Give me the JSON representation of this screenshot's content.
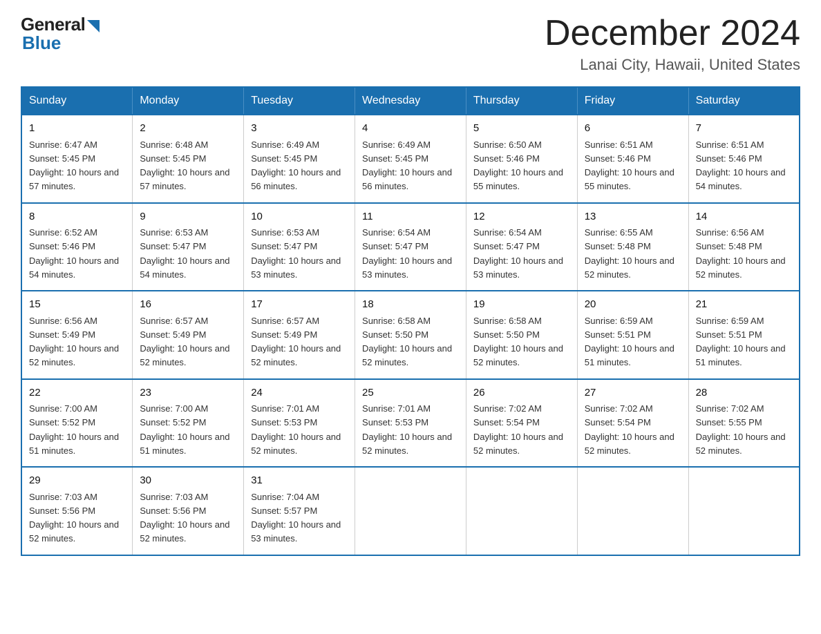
{
  "logo": {
    "general": "General",
    "blue": "Blue",
    "triangle_color": "#1a6faf"
  },
  "title": {
    "month_year": "December 2024",
    "location": "Lanai City, Hawaii, United States"
  },
  "weekdays": [
    "Sunday",
    "Monday",
    "Tuesday",
    "Wednesday",
    "Thursday",
    "Friday",
    "Saturday"
  ],
  "weeks": [
    [
      {
        "day": "1",
        "sunrise": "6:47 AM",
        "sunset": "5:45 PM",
        "daylight": "10 hours and 57 minutes."
      },
      {
        "day": "2",
        "sunrise": "6:48 AM",
        "sunset": "5:45 PM",
        "daylight": "10 hours and 57 minutes."
      },
      {
        "day": "3",
        "sunrise": "6:49 AM",
        "sunset": "5:45 PM",
        "daylight": "10 hours and 56 minutes."
      },
      {
        "day": "4",
        "sunrise": "6:49 AM",
        "sunset": "5:45 PM",
        "daylight": "10 hours and 56 minutes."
      },
      {
        "day": "5",
        "sunrise": "6:50 AM",
        "sunset": "5:46 PM",
        "daylight": "10 hours and 55 minutes."
      },
      {
        "day": "6",
        "sunrise": "6:51 AM",
        "sunset": "5:46 PM",
        "daylight": "10 hours and 55 minutes."
      },
      {
        "day": "7",
        "sunrise": "6:51 AM",
        "sunset": "5:46 PM",
        "daylight": "10 hours and 54 minutes."
      }
    ],
    [
      {
        "day": "8",
        "sunrise": "6:52 AM",
        "sunset": "5:46 PM",
        "daylight": "10 hours and 54 minutes."
      },
      {
        "day": "9",
        "sunrise": "6:53 AM",
        "sunset": "5:47 PM",
        "daylight": "10 hours and 54 minutes."
      },
      {
        "day": "10",
        "sunrise": "6:53 AM",
        "sunset": "5:47 PM",
        "daylight": "10 hours and 53 minutes."
      },
      {
        "day": "11",
        "sunrise": "6:54 AM",
        "sunset": "5:47 PM",
        "daylight": "10 hours and 53 minutes."
      },
      {
        "day": "12",
        "sunrise": "6:54 AM",
        "sunset": "5:47 PM",
        "daylight": "10 hours and 53 minutes."
      },
      {
        "day": "13",
        "sunrise": "6:55 AM",
        "sunset": "5:48 PM",
        "daylight": "10 hours and 52 minutes."
      },
      {
        "day": "14",
        "sunrise": "6:56 AM",
        "sunset": "5:48 PM",
        "daylight": "10 hours and 52 minutes."
      }
    ],
    [
      {
        "day": "15",
        "sunrise": "6:56 AM",
        "sunset": "5:49 PM",
        "daylight": "10 hours and 52 minutes."
      },
      {
        "day": "16",
        "sunrise": "6:57 AM",
        "sunset": "5:49 PM",
        "daylight": "10 hours and 52 minutes."
      },
      {
        "day": "17",
        "sunrise": "6:57 AM",
        "sunset": "5:49 PM",
        "daylight": "10 hours and 52 minutes."
      },
      {
        "day": "18",
        "sunrise": "6:58 AM",
        "sunset": "5:50 PM",
        "daylight": "10 hours and 52 minutes."
      },
      {
        "day": "19",
        "sunrise": "6:58 AM",
        "sunset": "5:50 PM",
        "daylight": "10 hours and 52 minutes."
      },
      {
        "day": "20",
        "sunrise": "6:59 AM",
        "sunset": "5:51 PM",
        "daylight": "10 hours and 51 minutes."
      },
      {
        "day": "21",
        "sunrise": "6:59 AM",
        "sunset": "5:51 PM",
        "daylight": "10 hours and 51 minutes."
      }
    ],
    [
      {
        "day": "22",
        "sunrise": "7:00 AM",
        "sunset": "5:52 PM",
        "daylight": "10 hours and 51 minutes."
      },
      {
        "day": "23",
        "sunrise": "7:00 AM",
        "sunset": "5:52 PM",
        "daylight": "10 hours and 51 minutes."
      },
      {
        "day": "24",
        "sunrise": "7:01 AM",
        "sunset": "5:53 PM",
        "daylight": "10 hours and 52 minutes."
      },
      {
        "day": "25",
        "sunrise": "7:01 AM",
        "sunset": "5:53 PM",
        "daylight": "10 hours and 52 minutes."
      },
      {
        "day": "26",
        "sunrise": "7:02 AM",
        "sunset": "5:54 PM",
        "daylight": "10 hours and 52 minutes."
      },
      {
        "day": "27",
        "sunrise": "7:02 AM",
        "sunset": "5:54 PM",
        "daylight": "10 hours and 52 minutes."
      },
      {
        "day": "28",
        "sunrise": "7:02 AM",
        "sunset": "5:55 PM",
        "daylight": "10 hours and 52 minutes."
      }
    ],
    [
      {
        "day": "29",
        "sunrise": "7:03 AM",
        "sunset": "5:56 PM",
        "daylight": "10 hours and 52 minutes."
      },
      {
        "day": "30",
        "sunrise": "7:03 AM",
        "sunset": "5:56 PM",
        "daylight": "10 hours and 52 minutes."
      },
      {
        "day": "31",
        "sunrise": "7:04 AM",
        "sunset": "5:57 PM",
        "daylight": "10 hours and 53 minutes."
      },
      null,
      null,
      null,
      null
    ]
  ]
}
